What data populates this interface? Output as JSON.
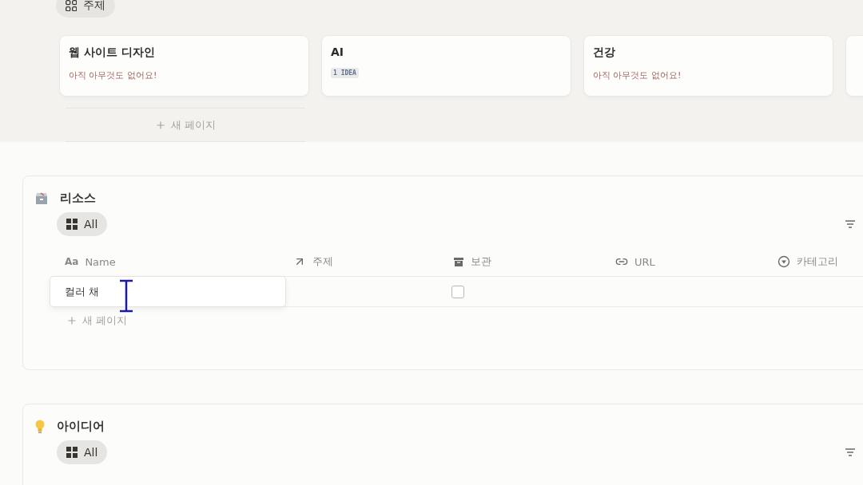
{
  "topics": {
    "view_tab": {
      "label": "주제",
      "selected": true
    },
    "cards": [
      {
        "kind": "empty",
        "title": "웹 사이트 디자인",
        "note": "아직 아무것도 없어요!"
      },
      {
        "kind": "count",
        "title": "AI",
        "badge": "1 IDEA"
      },
      {
        "kind": "empty",
        "title": "건강",
        "note": "아직 아무것도 없어요!"
      },
      {
        "kind": "partial"
      }
    ],
    "new_page": "새 페이지"
  },
  "resources": {
    "title": "리소스",
    "view_tab": {
      "label": "All",
      "selected": true
    },
    "columns": [
      {
        "kind": "title",
        "glyph": "Aa",
        "label": "Name"
      },
      {
        "kind": "relation",
        "label": "주제"
      },
      {
        "kind": "checkbox",
        "label": "보관"
      },
      {
        "kind": "url",
        "label": "URL"
      },
      {
        "kind": "select",
        "label": "카테고리"
      }
    ],
    "rows": [
      {
        "name": "컬러 채",
        "editing": true,
        "archived": false
      }
    ],
    "new_page": "새 페이지"
  },
  "ideas": {
    "title": "아이디어",
    "view_tab": {
      "label": "All",
      "selected": true
    }
  }
}
